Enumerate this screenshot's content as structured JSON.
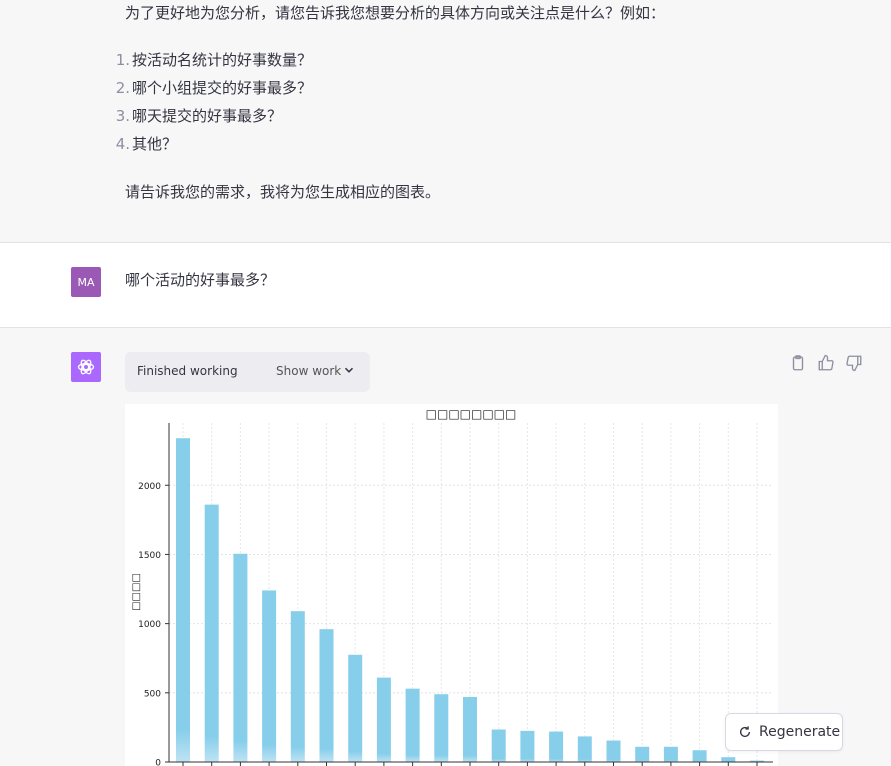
{
  "assistant_prev": {
    "intro": "为了更好地为您分析，请您告诉我您想要分析的具体方向或关注点是什么？例如：",
    "options": [
      {
        "num": "1.",
        "text": "按活动名统计的好事数量？"
      },
      {
        "num": "2.",
        "text": "哪个小组提交的好事最多？"
      },
      {
        "num": "3.",
        "text": "哪天提交的好事最多？"
      },
      {
        "num": "4.",
        "text": "其他？"
      }
    ],
    "outro": "请告诉我您的需求，我将为您生成相应的图表。"
  },
  "user_msg": {
    "avatar": "MA",
    "text": "哪个活动的好事最多？"
  },
  "assistant": {
    "work_status": "Finished working",
    "show_work": "Show work",
    "icons": [
      "openai-logo-icon",
      "chevron-down-icon",
      "clipboard-icon",
      "thumbs-up-icon",
      "thumbs-down-icon"
    ]
  },
  "regenerate_label": "Regenerate",
  "chart_data": {
    "type": "bar",
    "title": "□□□□□□□□",
    "ylabel": "□□□□",
    "xlabel": "",
    "categories": [
      "",
      "",
      "",
      "",
      "",
      "",
      "",
      "",
      "",
      "",
      "",
      "",
      "",
      "",
      "",
      "",
      "",
      "",
      "",
      "",
      ""
    ],
    "values": [
      2340,
      1860,
      1505,
      1240,
      1090,
      960,
      775,
      610,
      530,
      490,
      470,
      235,
      225,
      220,
      185,
      155,
      110,
      110,
      85,
      35,
      10
    ],
    "yticks": [
      0,
      500,
      1000,
      1500,
      2000
    ],
    "ylim": [
      0,
      2450
    ],
    "grid": true,
    "bar_color": "#87ceeb"
  }
}
